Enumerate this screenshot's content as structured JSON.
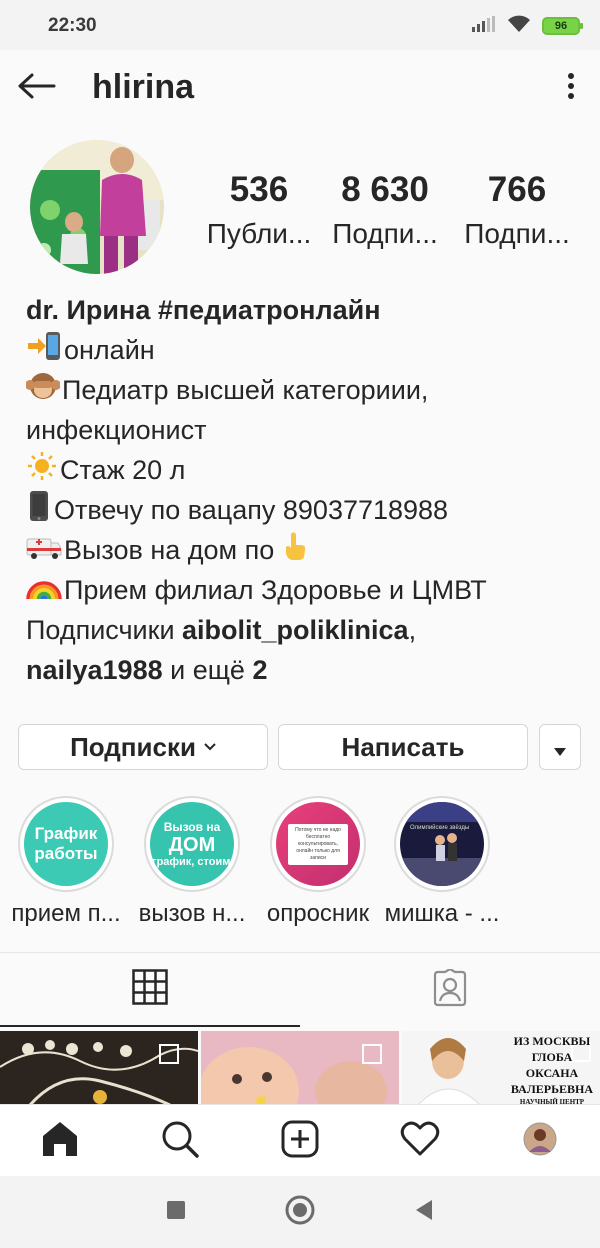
{
  "status_bar": {
    "time": "22:30",
    "battery": "96",
    "icons": [
      "signal-icon",
      "wifi-icon",
      "battery-icon"
    ]
  },
  "header": {
    "username": "hlirina",
    "icons": [
      "back-arrow-icon",
      "more-vertical-icon"
    ]
  },
  "stats": [
    {
      "value": "536",
      "label": "Публи..."
    },
    {
      "value": "8 630",
      "label": "Подпи..."
    },
    {
      "value": "766",
      "label": "Подпи..."
    }
  ],
  "bio": {
    "name": "dr. Ирина #педиатронлайн",
    "lines": [
      {
        "emoji": "phone-arrow-icon",
        "text": "онлайн"
      },
      {
        "emoji": "monkey-icon",
        "text": "Педиатр  высшей категориии,"
      },
      {
        "emoji": "",
        "text": "инфекционист"
      },
      {
        "emoji": "sun-icon",
        "text": "Стаж 20 л"
      },
      {
        "emoji": "mobile-phone-icon",
        "text": "Отвечу по вацапу 89037718988"
      },
      {
        "emoji": "ambulance-icon",
        "text": "Вызов на дом по "
      },
      {
        "emoji": "rainbow-icon",
        "text": "Прием филиал Здоровье  и ЦМВТ"
      }
    ],
    "followers_prefix": "Подписчики ",
    "follower_1": "aibolit_poliklinica",
    "comma": ",",
    "follower_2": "nailya1988",
    "and_more": " и ещё ",
    "more_count": "2"
  },
  "buttons": {
    "following": "Подписки",
    "message": "Написать"
  },
  "highlights": [
    {
      "label": "прием п...",
      "cover_text": "График работы",
      "color": "#3cc9b4"
    },
    {
      "label": "вызов н...",
      "cover_text_1": "Вызов на",
      "cover_text_2": "ДОМ",
      "cover_text_3": "график, стоимость",
      "color": "#37c4ae"
    },
    {
      "label": "опросник",
      "cover_text": "Потому что не надо бесплатно консультировать, онлайн только для записи",
      "color": "#e2437e"
    },
    {
      "label": "мишка - ...",
      "cover_text": "Олимпийские звёзды",
      "color": "#1a1a40"
    }
  ],
  "tabs": {
    "icons": [
      "grid-icon",
      "tagged-person-icon"
    ]
  },
  "grid_posts": [
    {
      "name": "post-embroidery"
    },
    {
      "name": "post-baby-photo"
    },
    {
      "name": "post-doctor-photo",
      "text_1": "ИЗ МОСКВЫ",
      "text_2": "ГЛОБА",
      "text_3": "ОКСАНА",
      "text_4": "ВАЛЕРЬЕВНА",
      "text_5": "НАУЧНЫЙ ЦЕНТР"
    }
  ],
  "bottom_nav": {
    "icons": [
      "home-icon",
      "search-icon",
      "add-post-icon",
      "heart-icon",
      "profile-avatar-icon"
    ]
  },
  "system_nav": {
    "icons": [
      "recent-apps-icon",
      "home-circle-icon",
      "back-triangle-icon"
    ]
  },
  "colors": {
    "text": "#262626",
    "border": "#dbdbdb",
    "accent_green": "#77d447"
  }
}
